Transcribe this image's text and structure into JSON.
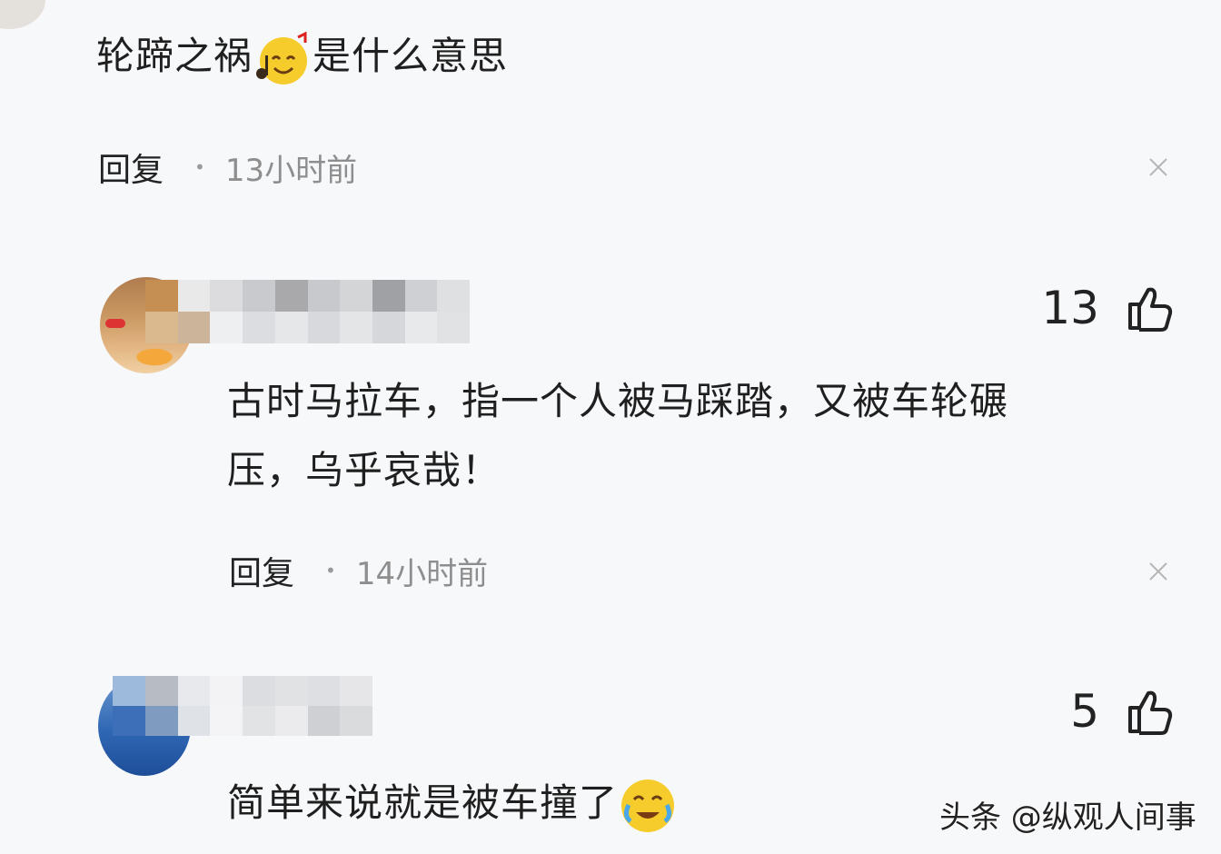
{
  "top_comment": {
    "text_before_emoji": "轮蹄之祸",
    "emoji_icon": "music-smile-emoji",
    "text_after_emoji": "是什么意思",
    "reply_label": "回复",
    "time": "13小时前"
  },
  "comments": [
    {
      "username_visible": false,
      "likes": "13",
      "text_line1": "古时马拉车，指一个人被马踩踏，又被车轮碾",
      "text_line2": "压，乌乎哀哉！",
      "reply_label": "回复",
      "time": "14小时前"
    },
    {
      "username_visible": false,
      "likes": "5",
      "text": "简单来说就是被车撞了",
      "emoji_icon": "crying-laugh-emoji"
    }
  ],
  "watermark": "头条 @纵观人间事",
  "colors": {
    "background": "#f7f8fa",
    "text": "#1f1f1f",
    "meta": "#8e8e8e",
    "emoji": "#f6cc2c"
  }
}
